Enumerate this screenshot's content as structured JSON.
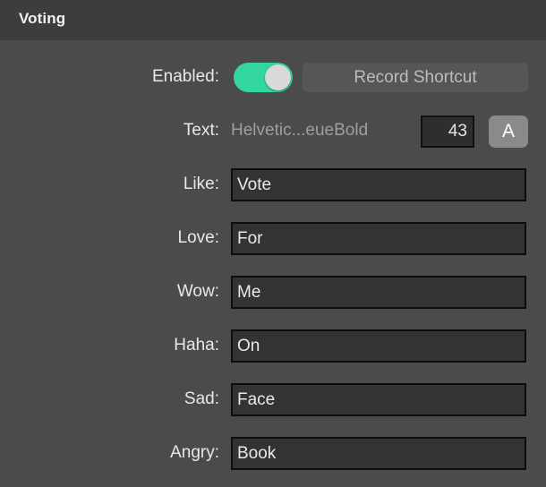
{
  "window": {
    "title": "Voting"
  },
  "form": {
    "enabled": {
      "label": "Enabled:",
      "toggle_state": "on",
      "toggle_on_color": "#33d69f",
      "knob_color": "#d9d9d9",
      "record_shortcut_label": "Record Shortcut"
    },
    "text": {
      "label": "Text:",
      "font_name": "Helvetic...eueBold",
      "font_size": "43",
      "font_button_label": "A"
    },
    "reactions": [
      {
        "label": "Like:",
        "value": "Vote"
      },
      {
        "label": "Love:",
        "value": "For"
      },
      {
        "label": "Wow:",
        "value": "Me"
      },
      {
        "label": "Haha:",
        "value": "On"
      },
      {
        "label": "Sad:",
        "value": "Face"
      },
      {
        "label": "Angry:",
        "value": "Book"
      }
    ]
  },
  "theme": {
    "titlebar_bg": "#3d3d3d",
    "panel_bg": "#4b4b4b",
    "field_bg": "#333333",
    "field_border": "#0d0d0d",
    "label_color": "#e8e8e8",
    "muted_text": "#9e9e9e"
  }
}
